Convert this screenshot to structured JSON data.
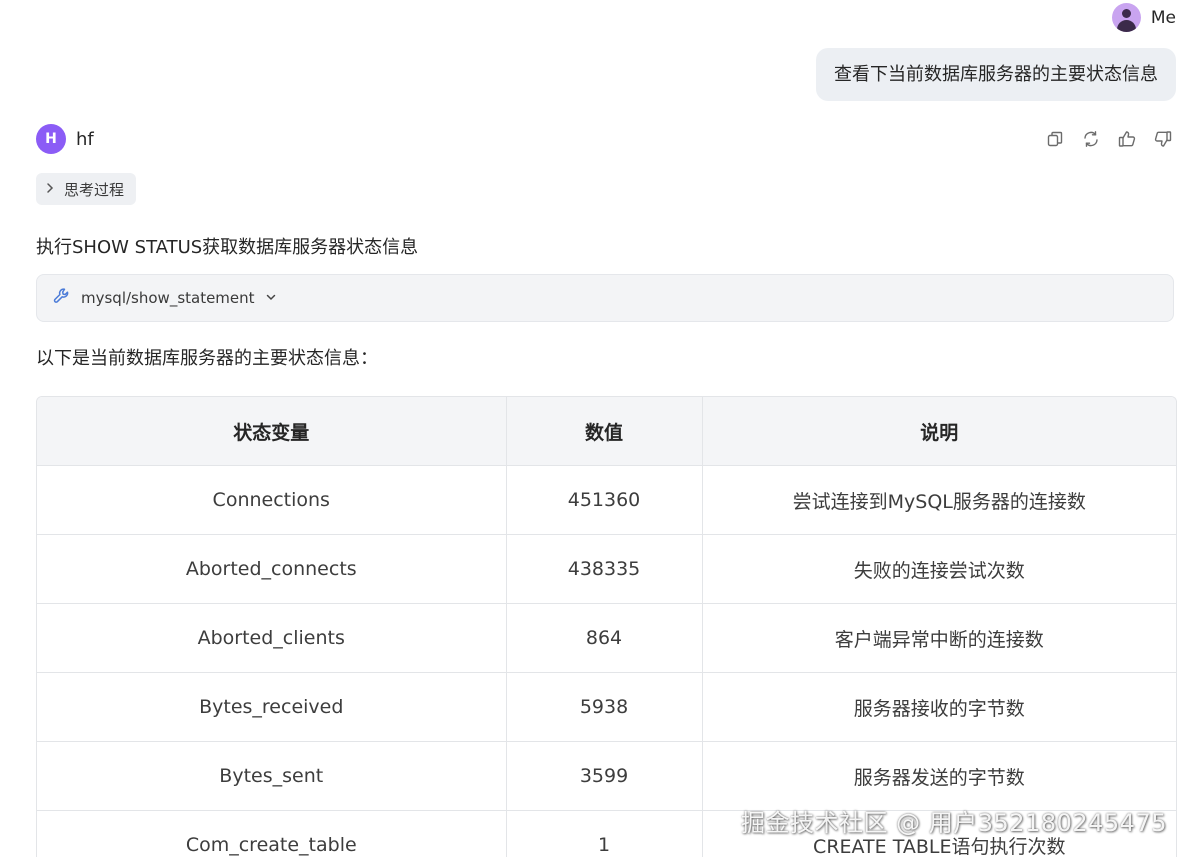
{
  "user": {
    "name": "Me",
    "message": "查看下当前数据库服务器的主要状态信息"
  },
  "assistant": {
    "avatar_letter": "H",
    "name": "hf",
    "thinking_label": "思考过程",
    "intro": "执行SHOW STATUS获取数据库服务器状态信息",
    "tool_label": "mysql/show_statement",
    "summary": "以下是当前数据库服务器的主要状态信息："
  },
  "actions": [
    "copy-icon",
    "refresh-icon",
    "thumbs-up-icon",
    "thumbs-down-icon"
  ],
  "table": {
    "headers": [
      "状态变量",
      "数值",
      "说明"
    ],
    "rows": [
      [
        "Connections",
        "451360",
        "尝试连接到MySQL服务器的连接数"
      ],
      [
        "Aborted_connects",
        "438335",
        "失败的连接尝试次数"
      ],
      [
        "Aborted_clients",
        "864",
        "客户端异常中断的连接数"
      ],
      [
        "Bytes_received",
        "5938",
        "服务器接收的字节数"
      ],
      [
        "Bytes_sent",
        "3599",
        "服务器发送的字节数"
      ],
      [
        "Com_create_table",
        "1",
        "CREATE TABLE语句执行次数"
      ]
    ]
  },
  "watermark": "掘金技术社区 @ 用户352180245475",
  "colors": {
    "avatar_bot": "#8b5cf6",
    "avatar_user": "#c9a4f0",
    "bubble_bg": "#eceff3",
    "table_header_bg": "#f4f5f7",
    "tool_icon": "#4b7bd8"
  }
}
